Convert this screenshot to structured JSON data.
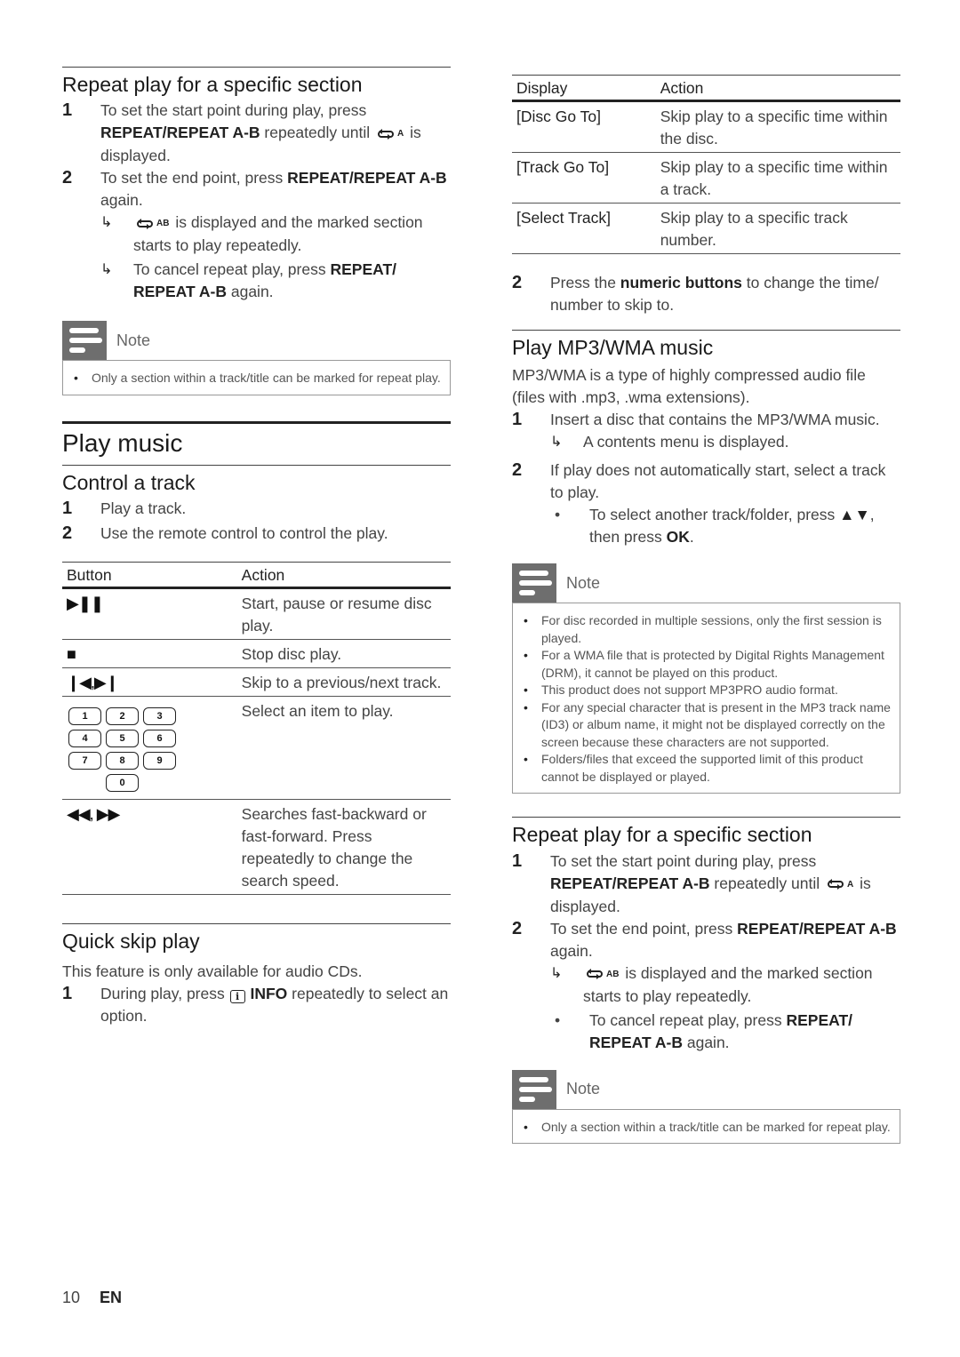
{
  "left": {
    "repeat_section": {
      "title": "Repeat play for a specific section",
      "step1": {
        "num": "1",
        "pre": "To set the start point during play, press ",
        "bold": "REPEAT/REPEAT A-B",
        "mid": " repeatedly until ",
        "icon_sup": "A",
        "post": " is displayed."
      },
      "step2": {
        "num": "2",
        "pre": "To set the end point, press ",
        "bold": "REPEAT/REPEAT A-B",
        "post": " again."
      },
      "result1": {
        "icon_sup": "AB",
        "text": " is displayed and the marked section starts to play repeatedly."
      },
      "result2": {
        "pre": "To cancel repeat play, press ",
        "bold": "REPEAT/ REPEAT A-B",
        "post": " again."
      },
      "note": {
        "label": "Note",
        "items": [
          "Only a section within a track/title can be marked for repeat play."
        ]
      }
    },
    "chapter_title": "Play music",
    "control_track": {
      "title": "Control a track",
      "steps": [
        {
          "num": "1",
          "text": "Play a track."
        },
        {
          "num": "2",
          "text": "Use the remote control to control the play."
        }
      ],
      "table": {
        "headers": [
          "Button",
          "Action"
        ],
        "rows": [
          {
            "button": "▶❚❚",
            "icon": "play-pause-icon",
            "action": "Start, pause or resume disc play."
          },
          {
            "button": "■",
            "icon": "stop-icon",
            "action": "Stop disc play."
          },
          {
            "button": "❙◀,▶❙",
            "icon": "skip-prev-next-icon",
            "action": "Skip to a previous/next track."
          },
          {
            "button": "keypad",
            "icon": "numeric-keypad-icon",
            "action": "Select an item to play.",
            "keys": [
              "1",
              "2",
              "3",
              "4",
              "5",
              "6",
              "7",
              "8",
              "9",
              "0"
            ]
          },
          {
            "button": "◀◀, ▶▶",
            "icon": "fast-backward-forward-icon",
            "action": "Searches fast-backward or fast-forward. Press repeatedly to change the search speed."
          }
        ]
      }
    },
    "quick_skip": {
      "title": "Quick skip play",
      "intro": "This feature is only available for audio CDs.",
      "step1": {
        "num": "1",
        "pre": "During play, press ",
        "icon_glyph": "i",
        "bold": "INFO",
        "post": " repeatedly to select an option."
      }
    }
  },
  "right": {
    "display_table": {
      "headers": [
        "Display",
        "Action"
      ],
      "rows": [
        {
          "display": "[Disc Go To]",
          "action": "Skip play to a specific time within the disc."
        },
        {
          "display": "[Track Go To]",
          "action": "Skip play to a specific time within a track."
        },
        {
          "display": "[Select Track]",
          "action": "Skip play to a specific track number."
        }
      ]
    },
    "step2": {
      "num": "2",
      "pre": "Press the ",
      "bold": "numeric buttons",
      "post": " to change the time/ number to skip to."
    },
    "mp3": {
      "title": "Play MP3/WMA music",
      "intro": "MP3/WMA is a type of highly compressed audio file (files with .mp3, .wma extensions).",
      "step1": {
        "num": "1",
        "text": "Insert a disc that contains the MP3/WMA music."
      },
      "step1_result": "A contents menu is displayed.",
      "step2": {
        "num": "2",
        "text": "If play does not automatically start, select a track to play."
      },
      "step2_bullet": {
        "pre": "To select another track/folder, press ",
        "arrows": "▲▼",
        "mid": ", then press ",
        "bold": "OK",
        "post": "."
      },
      "note": {
        "label": "Note",
        "items": [
          "For disc recorded in multiple sessions, only the first session is played.",
          "For a WMA file that is protected by Digital Rights Management (DRM), it cannot be played on this product.",
          "This product does not support MP3PRO audio format.",
          "For any special character that is present in the MP3 track name (ID3) or album name, it might not be displayed correctly on the screen because these characters are not supported.",
          "Folders/files that exceed the supported limit of this product cannot be displayed or played."
        ]
      }
    },
    "repeat_section": {
      "title": "Repeat play for a specific section",
      "step1": {
        "num": "1",
        "pre": "To set the start point during play, press ",
        "bold": "REPEAT/REPEAT A-B",
        "mid": " repeatedly until ",
        "icon_sup": "A",
        "post": " is displayed."
      },
      "step2": {
        "num": "2",
        "pre": "To set the end point, press ",
        "bold": "REPEAT/REPEAT A-B",
        "post": " again."
      },
      "result1": {
        "icon_sup": "AB",
        "text": " is displayed and the marked section starts to play repeatedly."
      },
      "bullet": {
        "pre": "To cancel repeat play, press ",
        "bold": "REPEAT/ REPEAT A-B",
        "post": " again."
      },
      "note": {
        "label": "Note",
        "items": [
          "Only a section within a track/title can be marked for repeat play."
        ]
      }
    }
  },
  "footer": {
    "page_number": "10",
    "language": "EN"
  },
  "symbols": {
    "result_arrow": "↳",
    "bullet": "•"
  }
}
